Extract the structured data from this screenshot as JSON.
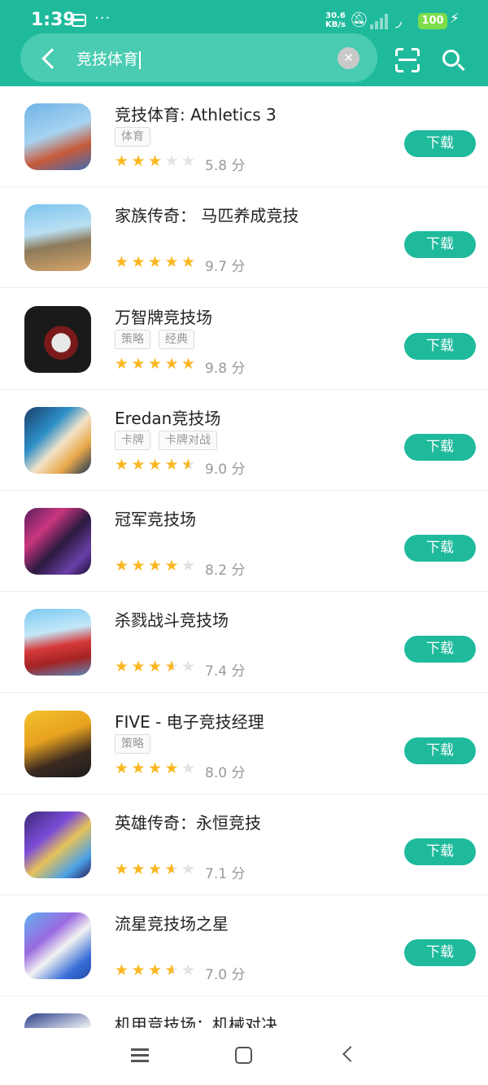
{
  "status_bar": {
    "time": "1:39",
    "dots": "···",
    "net_speed_value": "30.6",
    "net_speed_unit": "KB/s",
    "battery": "100"
  },
  "search": {
    "query": "竞技体育",
    "clear_icon": "close-icon",
    "back_icon": "back-arrow-icon",
    "scan_icon": "scan-icon",
    "search_icon": "search-icon"
  },
  "colors": {
    "accent": "#1fba9c",
    "star": "#fbb722",
    "star_empty": "#e2e2e2"
  },
  "apps": [
    {
      "name": "竞技体育: Athletics 3",
      "tags": [
        "体育"
      ],
      "rating_stars": 3,
      "score": "5.8 分",
      "button": "下载"
    },
    {
      "name": "家族传奇： 马匹养成竞技",
      "tags": [],
      "rating_stars": 5,
      "score": "9.7 分",
      "button": "下载"
    },
    {
      "name": "万智牌竞技场",
      "tags": [
        "策略",
        "经典"
      ],
      "rating_stars": 5,
      "score": "9.8 分",
      "button": "下载"
    },
    {
      "name": "Eredan竞技场",
      "tags": [
        "卡牌",
        "卡牌对战"
      ],
      "rating_stars": 4.5,
      "score": "9.0 分",
      "button": "下载"
    },
    {
      "name": "冠军竞技场",
      "tags": [],
      "rating_stars": 4,
      "score": "8.2 分",
      "button": "下载"
    },
    {
      "name": "杀戮战斗竞技场",
      "tags": [],
      "rating_stars": 3.5,
      "score": "7.4 分",
      "button": "下载"
    },
    {
      "name": "FIVE - 电子竞技经理",
      "tags": [
        "策略"
      ],
      "rating_stars": 4,
      "score": "8.0 分",
      "button": "下载"
    },
    {
      "name": "英雄传奇：永恒竞技",
      "tags": [],
      "rating_stars": 3.5,
      "score": "7.1 分",
      "button": "下载"
    },
    {
      "name": "流星竞技场之星",
      "tags": [],
      "rating_stars": 3.5,
      "score": "7.0 分",
      "button": "下载"
    },
    {
      "name": "机甲竞技场：机械对决",
      "tags": [],
      "rating_stars": 0,
      "score": "",
      "button": ""
    }
  ],
  "nav": {
    "menu_icon": "menu-icon",
    "home_icon": "home-icon",
    "back_icon": "back-icon"
  }
}
